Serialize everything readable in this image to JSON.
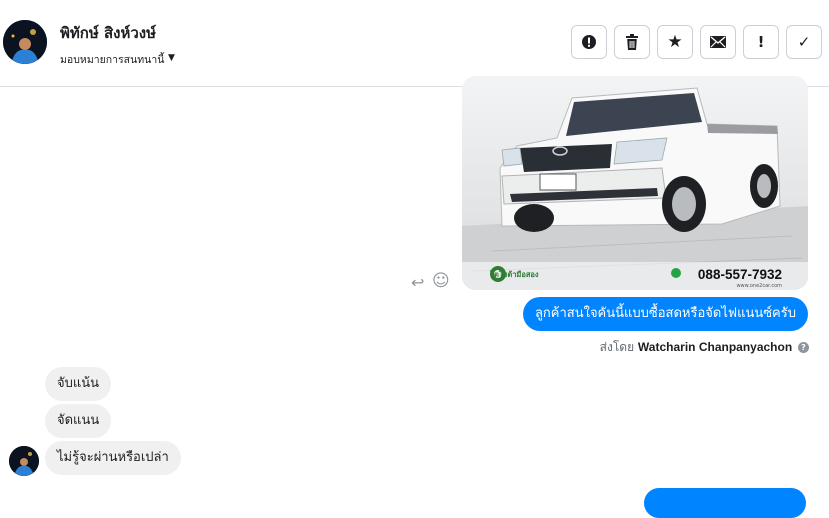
{
  "header": {
    "contact_name": "พิทักษ์ สิงห์วงษ์",
    "assign_label": "มอบหมายการสนทนานี้",
    "toolbar": [
      {
        "name": "report-button",
        "icon": "alert-circle-icon",
        "glyph": "⚠"
      },
      {
        "name": "delete-button",
        "icon": "trash-icon",
        "glyph": "🗑"
      },
      {
        "name": "star-button",
        "icon": "star-icon",
        "glyph": "★"
      },
      {
        "name": "mark-unread-button",
        "icon": "envelope-icon",
        "glyph": "✉"
      },
      {
        "name": "important-button",
        "icon": "exclamation-icon",
        "glyph": "!"
      },
      {
        "name": "mark-done-button",
        "icon": "check-icon",
        "glyph": "✓"
      }
    ]
  },
  "messages": {
    "photo": {
      "phone": "088-557-7932",
      "website": "www.one2car.com",
      "dealer": "โตโยต้ามือสอง"
    },
    "outgoing": {
      "text": "ลูกค้าสนใจคันนี้แบบซื้อสดหรือจัดไฟแนนซ์ครับ",
      "sent_by_prefix": "ส่งโดย",
      "sent_by_name": "Watcharin Chanpanyachon"
    },
    "incoming": [
      {
        "text": "จับแน้น"
      },
      {
        "text": "จัดแนน"
      },
      {
        "text": "ไม่รู้จะผ่านหรือเปล่า"
      }
    ]
  },
  "colors": {
    "accent": "#0084ff",
    "incoming_bubble": "#f1f0f0",
    "border": "#ccd0d5"
  }
}
